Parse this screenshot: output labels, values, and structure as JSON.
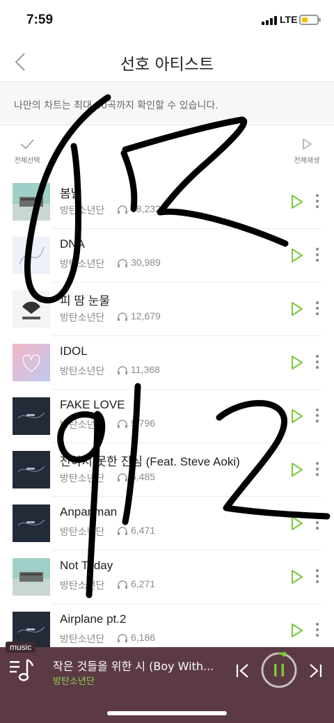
{
  "status": {
    "time": "7:59",
    "network": "LTE"
  },
  "header": {
    "title": "선호 아티스트"
  },
  "notice": {
    "text": "나만의 차트는 최대 30곡까지 확인할 수 있습니다."
  },
  "toolbar": {
    "select_all_label": "전체선택",
    "play_all_label": "전체재생"
  },
  "songs": [
    {
      "title": "봄날",
      "artist": "방탄소년단",
      "plays": "38,232"
    },
    {
      "title": "DNA",
      "artist": "방탄소년단",
      "plays": "30,989"
    },
    {
      "title": "피 땀 눈물",
      "artist": "방탄소년단",
      "plays": "12,679"
    },
    {
      "title": "IDOL",
      "artist": "방탄소년단",
      "plays": "11,368"
    },
    {
      "title": "FAKE LOVE",
      "artist": "방탄소년단",
      "plays": "9,796"
    },
    {
      "title": "전하지 못한 진심 (Feat. Steve Aoki)",
      "artist": "방탄소년단",
      "plays": "6,485"
    },
    {
      "title": "Anpanman",
      "artist": "방탄소년단",
      "plays": "6,471"
    },
    {
      "title": "Not Today",
      "artist": "방탄소년단",
      "plays": "6,271"
    },
    {
      "title": "Airplane pt.2",
      "artist": "방탄소년단",
      "plays": "6,186"
    }
  ],
  "player": {
    "tag": "music",
    "now_playing_title": "작은 것들을 위한 시 (Boy With...",
    "now_playing_artist": "방탄소년단",
    "progress": 0.05
  },
  "colors": {
    "accent": "#7cc63c",
    "player_bg": "#5c3a44",
    "artist_green": "#8fd14f"
  }
}
